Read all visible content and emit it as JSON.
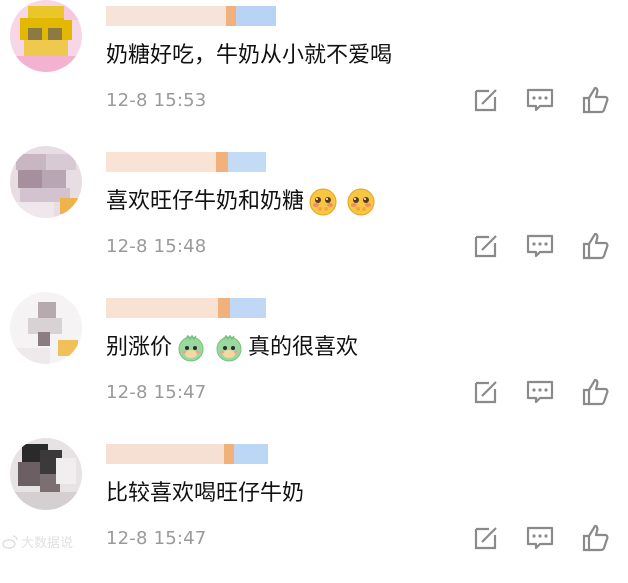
{
  "comments": [
    {
      "text_parts": [
        "奶糖好吃，牛奶从小就不爱喝"
      ],
      "emojis": [],
      "time": "12-8 15:53",
      "avatar_colors": [
        "#e6c200",
        "#f3b2d2",
        "#8d7a43"
      ]
    },
    {
      "text_parts": [
        "喜欢旺仔牛奶和奶糖"
      ],
      "emojis": [
        "shy-face-emoji",
        "shy-face-emoji"
      ],
      "time": "12-8 15:48",
      "avatar_colors": [
        "#b8a8b4",
        "#d2c3cf",
        "#f0b24a"
      ]
    },
    {
      "text_parts": [
        "别涨价",
        "真的很喜欢"
      ],
      "emojis": [
        "green-dino-emoji",
        "green-dino-emoji"
      ],
      "time": "12-8 15:47",
      "avatar_colors": [
        "#d9d2d4",
        "#f3f0f1",
        "#f1c05a"
      ]
    },
    {
      "text_parts": [
        "比较喜欢喝旺仔牛奶"
      ],
      "emojis": [],
      "time": "12-8 15:47",
      "avatar_colors": [
        "#2a2a2a",
        "#7b6f72",
        "#e7e2e3"
      ]
    }
  ],
  "watermark": {
    "text": "大数据说"
  },
  "icons": {
    "repost": "repost-icon",
    "reply": "comment-icon",
    "like": "like-icon"
  },
  "colors": {
    "text": "#111111",
    "time": "#9a9a9a",
    "icon": "#8a8a8a"
  }
}
